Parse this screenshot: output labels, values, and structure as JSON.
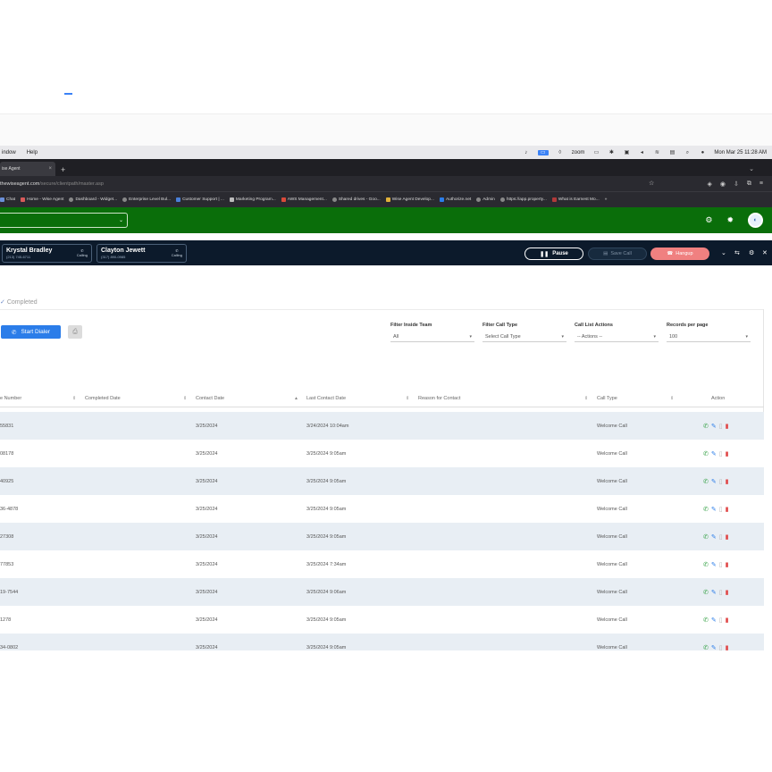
{
  "mac_menu": {
    "items": [
      "indow",
      "Help"
    ],
    "zoom": "zoom",
    "clock": "Mon Mar 25  11:28 AM"
  },
  "browser": {
    "tab_title": "ise Agent",
    "url_host": "thewiseagent.com",
    "url_path": "/secure/clientpath/master.asp",
    "bookmarks": [
      "Chat",
      "Home - Wise Agent",
      "Dashboard - Widget...",
      "Enterprise Level Bul...",
      "Customer Support | ...",
      "Marketing Program...",
      "AWS Management...",
      "Shared drives - Goo...",
      "Wise Agent Develop...",
      "Authorize.net",
      "Admin",
      "https://app.property...",
      "What is Earnest Mo..."
    ],
    "more": "»"
  },
  "dialer": {
    "callers": [
      {
        "name": "Krystal Bradley",
        "phone": "(213) 745-6711",
        "status": "Calling"
      },
      {
        "name": "Clayton Jewett",
        "phone": "(317) 890-0985",
        "status": "Calling"
      }
    ],
    "pause_label": "Pause",
    "save_label": "Save Call",
    "hangup_label": "Hangup"
  },
  "tab_completed": "Completed",
  "start_dialer_label": "Start Dialer",
  "filters": [
    {
      "label": "Filter Inside Team",
      "value": "All"
    },
    {
      "label": "Filter Call Type",
      "value": "Select Call Type"
    },
    {
      "label": "Call List Actions",
      "value": "-- Actions --"
    },
    {
      "label": "Records per page",
      "value": "100"
    }
  ],
  "table": {
    "headers": [
      "e Number",
      "Completed Date",
      "Contact Date",
      "Last Contact Date",
      "Reason for Contact",
      "Call Type",
      "Action"
    ],
    "rows": [
      {
        "number": "55831",
        "completed": "",
        "contact": "3/25/2024",
        "last": "3/24/2024 10:04am",
        "reason": "",
        "type": "Welcome Call"
      },
      {
        "number": "08178",
        "completed": "",
        "contact": "3/25/2024",
        "last": "3/25/2024 9:05am",
        "reason": "",
        "type": "Welcome Call"
      },
      {
        "number": "40925",
        "completed": "",
        "contact": "3/25/2024",
        "last": "3/25/2024 9:05am",
        "reason": "",
        "type": "Welcome Call"
      },
      {
        "number": "36-4878",
        "completed": "",
        "contact": "3/25/2024",
        "last": "3/25/2024 9:05am",
        "reason": "",
        "type": "Welcome Call"
      },
      {
        "number": "27308",
        "completed": "",
        "contact": "3/25/2024",
        "last": "3/25/2024 9:05am",
        "reason": "",
        "type": "Welcome Call"
      },
      {
        "number": "77853",
        "completed": "",
        "contact": "3/25/2024",
        "last": "3/25/2024 7:34am",
        "reason": "",
        "type": "Welcome Call"
      },
      {
        "number": "19-7544",
        "completed": "",
        "contact": "3/25/2024",
        "last": "3/25/2024 9:06am",
        "reason": "",
        "type": "Welcome Call"
      },
      {
        "number": "1278",
        "completed": "",
        "contact": "3/25/2024",
        "last": "3/25/2024 9:05am",
        "reason": "",
        "type": "Welcome Call"
      },
      {
        "number": "34-0802",
        "completed": "",
        "contact": "3/25/2024",
        "last": "3/25/2024 9:05am",
        "reason": "",
        "type": "Welcome Call"
      }
    ]
  },
  "colors": {
    "app_bar": "#0a6e0a",
    "dialer_bar": "#0c1a2b",
    "primary": "#2b7de9",
    "hangup": "#f08080",
    "row_alt": "#e8eef4"
  }
}
